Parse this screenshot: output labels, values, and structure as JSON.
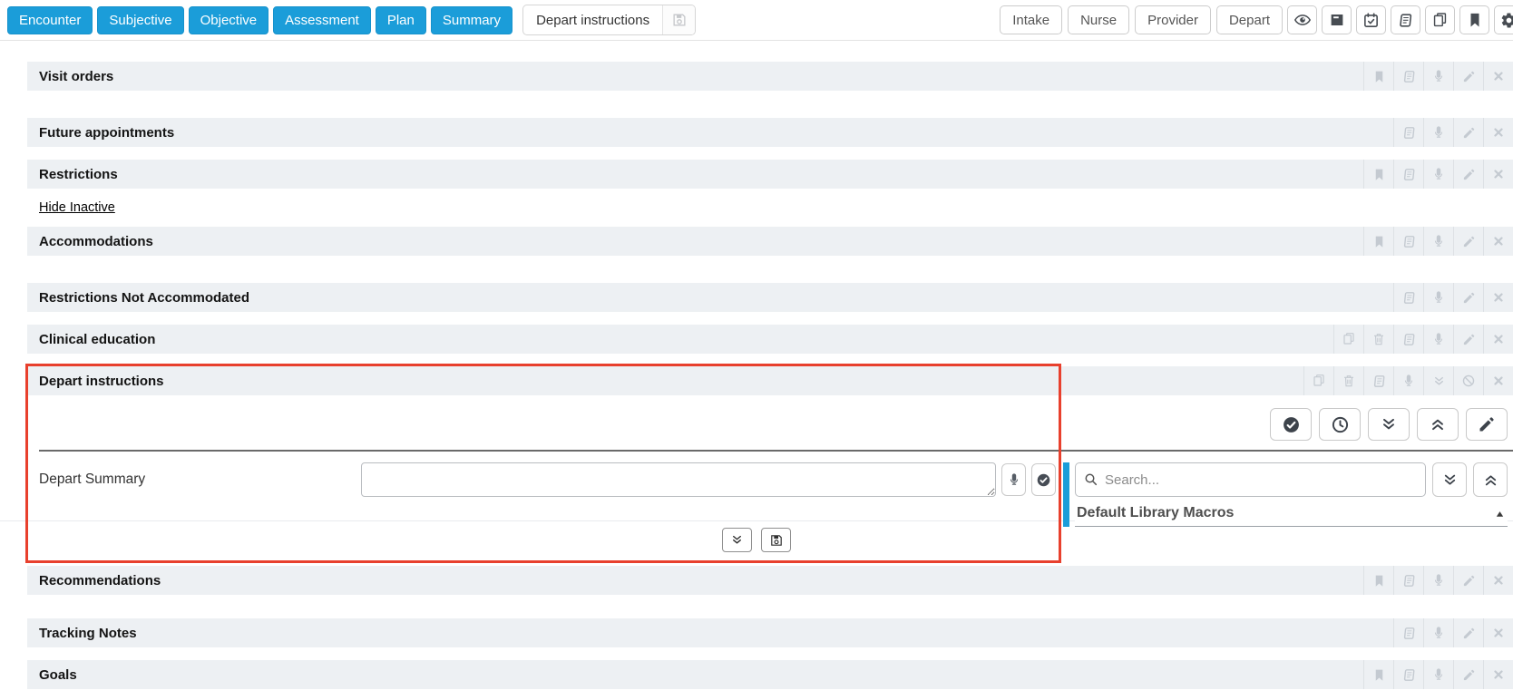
{
  "toolbar": {
    "nav_buttons": [
      {
        "label": "Encounter"
      },
      {
        "label": "Subjective"
      },
      {
        "label": "Objective"
      },
      {
        "label": "Assessment"
      },
      {
        "label": "Plan"
      },
      {
        "label": "Summary"
      }
    ],
    "active_section": {
      "label": "Depart instructions",
      "save_icon": "save-icon",
      "save_disabled": true
    },
    "stage_buttons": [
      {
        "label": "Intake"
      },
      {
        "label": "Nurse"
      },
      {
        "label": "Provider"
      },
      {
        "label": "Depart"
      }
    ],
    "icon_buttons": [
      "eye-icon",
      "archive-icon",
      "calendar-check-icon",
      "book-icon",
      "copy-icon",
      "bookmark-icon",
      "gear-icon"
    ]
  },
  "sections": [
    {
      "title": "Visit orders",
      "icons": [
        "bookmark",
        "book",
        "microphone",
        "pencil",
        "close"
      ]
    },
    {
      "title": "Future appointments",
      "icons": [
        "book",
        "microphone",
        "pencil",
        "close"
      ]
    },
    {
      "title": "Restrictions",
      "icons": [
        "bookmark",
        "book",
        "microphone",
        "pencil",
        "close"
      ]
    },
    {
      "title": "Accommodations",
      "icons": [
        "bookmark",
        "book",
        "microphone",
        "pencil",
        "close"
      ]
    },
    {
      "title": "Restrictions Not Accommodated",
      "icons": [
        "book",
        "microphone",
        "pencil",
        "close"
      ]
    },
    {
      "title": "Clinical education",
      "icons": [
        "copy",
        "trash",
        "book",
        "microphone",
        "pencil",
        "close"
      ]
    },
    {
      "title": "Depart instructions",
      "icons": [
        "copy",
        "trash",
        "book",
        "microphone",
        "chevrons-down",
        "ban",
        "close"
      ]
    },
    {
      "title": "Recommendations",
      "icons": [
        "bookmark",
        "book",
        "microphone",
        "pencil",
        "close"
      ]
    },
    {
      "title": "Tracking Notes",
      "icons": [
        "book",
        "microphone",
        "pencil",
        "close"
      ]
    },
    {
      "title": "Goals",
      "icons": [
        "bookmark",
        "book",
        "microphone",
        "pencil",
        "close"
      ]
    }
  ],
  "links": {
    "hide_inactive": "Hide Inactive"
  },
  "depart_panel": {
    "summary_label": "Depart Summary",
    "summary_value": "",
    "action_buttons": [
      "check-circle",
      "clock",
      "chevrons-down",
      "chevrons-up",
      "pencil"
    ],
    "footer_buttons": [
      "chevrons-down",
      "save"
    ],
    "macros": {
      "search_placeholder": "Search...",
      "header": "Default Library Macros",
      "collapse_icon": "triangle-up"
    }
  },
  "colors": {
    "accent_blue": "#1b9dd9",
    "annotation_red": "#e8402d",
    "row_background": "#edf0f3",
    "row_icon_gray": "#c4cad1",
    "dark_icon": "#3d434b"
  }
}
